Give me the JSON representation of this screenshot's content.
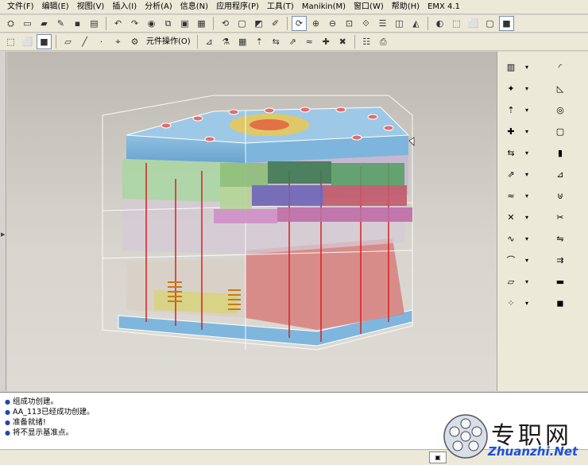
{
  "menubar": {
    "items": [
      "文件(F)",
      "编辑(E)",
      "视图(V)",
      "插入(I)",
      "分析(A)",
      "信息(N)",
      "应用程序(P)",
      "工具(T)",
      "Manikin(M)",
      "窗口(W)",
      "帮助(H)",
      "EMX 4.1"
    ]
  },
  "toolbar2": {
    "component_ops_label": "元件操作(O)"
  },
  "messages": [
    "组成功创建。",
    "AA_113已经成功创建。",
    "准备就绪!",
    "将不显示基准点。"
  ],
  "watermark": {
    "chinese": "专职网",
    "english": "Zhuanzhi.Net"
  },
  "colors": {
    "chrome": "#ece9d8",
    "viewport_top": "#bdb9b2",
    "message_bullet": "#2445a8",
    "watermark_blue": "#1d4fd8"
  },
  "icons": {
    "toolbar1": [
      "assembly-icon",
      "new-icon",
      "open-icon",
      "brush-icon",
      "save-icon",
      "print-icon",
      "undo-icon",
      "redo-icon",
      "color-icon",
      "copy-icon",
      "paste-icon",
      "paste-special-icon",
      "regenerate-icon",
      "window-icon",
      "repaint-icon",
      "sketch-view-icon",
      "spin-icon",
      "zoom-in-icon",
      "zoom-out-icon",
      "refit-icon",
      "orient-icon",
      "layers-icon",
      "view-manager-icon",
      "perspective-icon",
      "shading-icon",
      "wireframe-icon",
      "hidden-icon",
      "no-hidden-icon",
      "shaded-icon"
    ],
    "toolbar2": [
      "wireframe-box-icon",
      "hidden-box-icon",
      "shaded-box-icon",
      "plane-icon",
      "axis-icon",
      "point-icon",
      "csys-icon",
      "component-ops-icon",
      "measure-icon",
      "analysis-icon",
      "mold-icon",
      "ejector-icon",
      "slider-icon",
      "lifter-icon",
      "cooling-icon",
      "screw-icon",
      "delete-icon",
      "bom-icon",
      "drawing-icon"
    ],
    "rightbar": [
      "mold-base-icon",
      "new-component-icon",
      "ejector-pin-icon",
      "screw-icon",
      "slider-icon",
      "lifter-icon",
      "cooling-icon",
      "datum-point-icon",
      "curve-icon",
      "spline-icon",
      "plane-icon",
      "pattern-icon",
      "round-icon",
      "chamfer-icon",
      "hole-icon",
      "shell-icon",
      "rib-icon",
      "draft-icon",
      "merge-icon",
      "trim-icon",
      "mirror-icon",
      "offset-icon",
      "thicken-icon",
      "solidify-icon"
    ]
  }
}
